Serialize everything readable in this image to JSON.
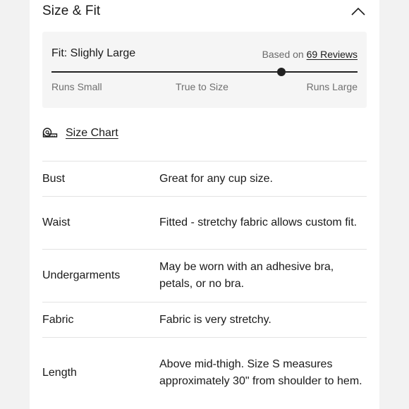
{
  "section": {
    "title": "Size & Fit",
    "toggle_icon": "chevron-up-icon"
  },
  "fit": {
    "label": "Fit: Slighly Large",
    "based_on_prefix": "Based on",
    "reviews_link": "69 Reviews",
    "scale_position": 0.75,
    "scale_left": "Runs Small",
    "scale_middle": "True to Size",
    "scale_right": "Runs Large"
  },
  "size_chart": {
    "icon": "measuring-tape-icon",
    "label": "Size Chart"
  },
  "specs": [
    {
      "name": "Bust",
      "value": "Great for any cup size."
    },
    {
      "name": "Waist",
      "value": "Fitted - stretchy fabric allows custom fit."
    },
    {
      "name": "Undergarments",
      "value": "May be worn with an adhesive bra, petals, or no bra."
    },
    {
      "name": "Fabric",
      "value": "Fabric is very stretchy."
    },
    {
      "name": "Length",
      "value": "Above mid-thigh. Size S measures approximately 30\" from shoulder to hem."
    }
  ]
}
